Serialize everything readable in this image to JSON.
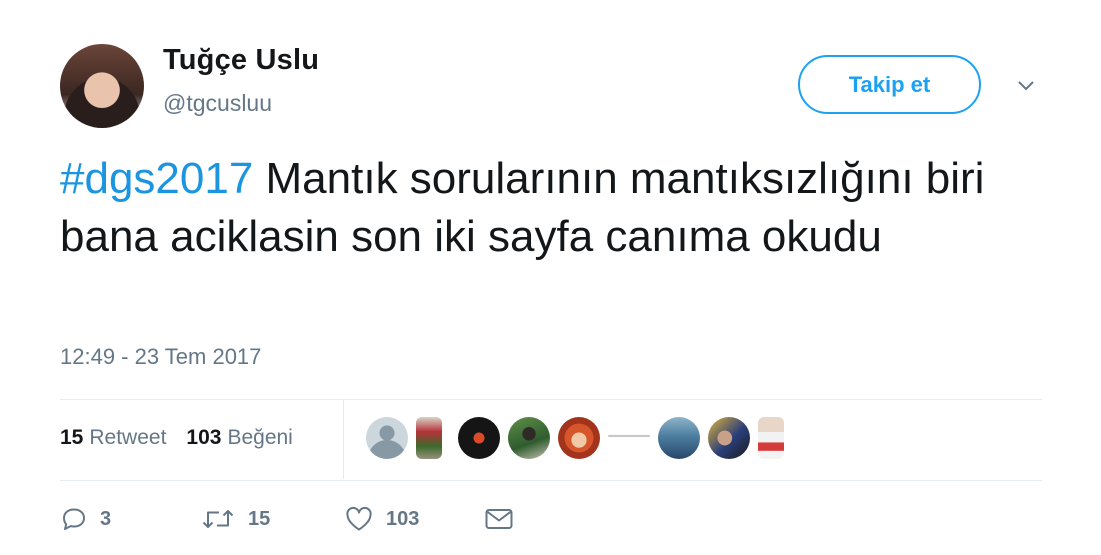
{
  "author": {
    "name": "Tuğçe Uslu",
    "handle": "@tgcusluu"
  },
  "follow_button": {
    "label": "Takip et"
  },
  "tweet": {
    "hashtag": "#dgs2017",
    "text": " Mantık sorularının mantıksızlığını biri bana aciklasin son iki sayfa canıma okudu",
    "timestamp": "12:49 - 23 Tem 2017"
  },
  "stats": {
    "retweets_count": "15",
    "retweets_label": "Retweet",
    "likes_count": "103",
    "likes_label": "Beğeni"
  },
  "actions": {
    "reply_count": "3",
    "retweet_count": "15",
    "like_count": "103"
  },
  "colors": {
    "accent": "#1da1f2",
    "hashtag": "#1b95e0",
    "muted": "#657786",
    "text": "#14171a",
    "divider": "#e6ecf0"
  },
  "icons": {
    "caret": "chevron-down-icon",
    "reply": "reply-icon",
    "retweet": "retweet-icon",
    "like": "heart-icon",
    "message": "envelope-icon"
  }
}
